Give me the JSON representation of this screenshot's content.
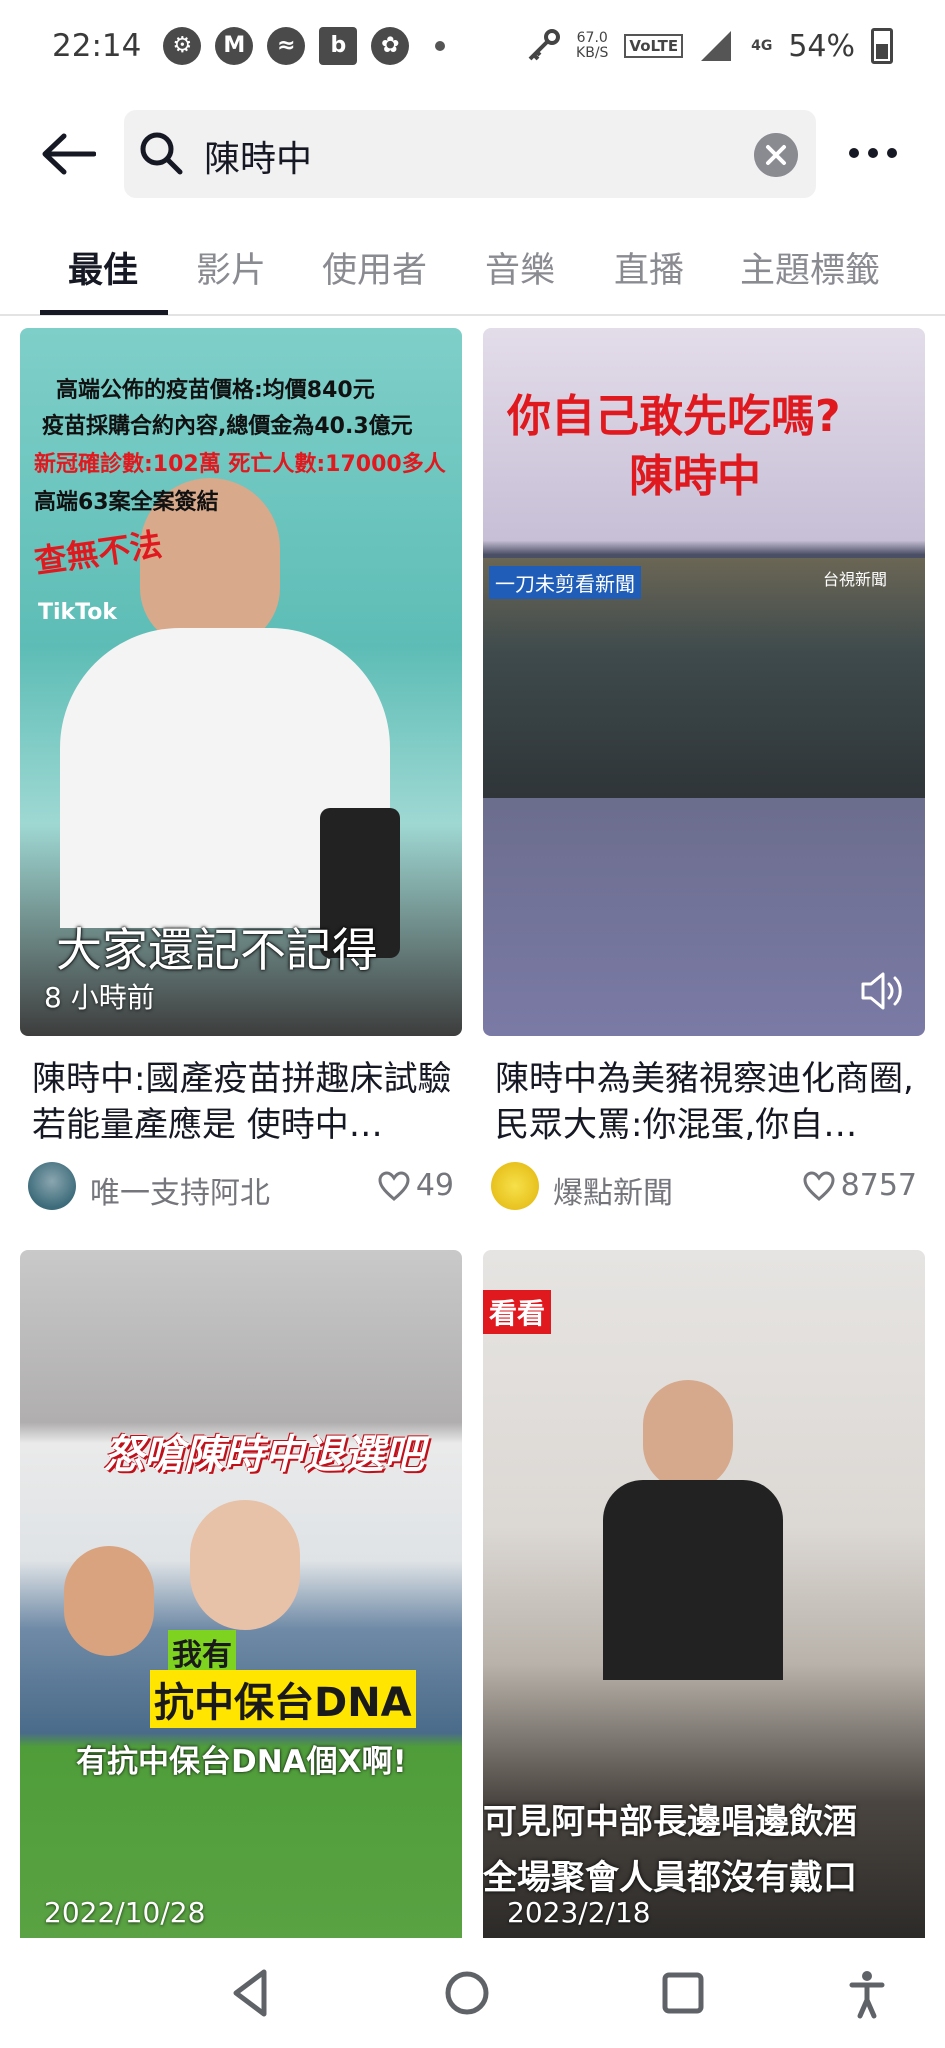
{
  "status_bar": {
    "time": "22:14",
    "net_speed_value": "67.0",
    "net_speed_unit": "KB/S",
    "volte": "VoLTE",
    "network": "4G",
    "battery": "54%"
  },
  "search": {
    "query": "陳時中",
    "back_icon": "arrow-left-icon",
    "clear_icon": "close-circle-icon",
    "more_icon": "ellipsis-icon"
  },
  "tabs": [
    {
      "label": "最佳",
      "active": true
    },
    {
      "label": "影片",
      "active": false
    },
    {
      "label": "使用者",
      "active": false
    },
    {
      "label": "音樂",
      "active": false
    },
    {
      "label": "直播",
      "active": false
    },
    {
      "label": "主題標籤",
      "active": false
    }
  ],
  "videos": [
    {
      "overlay_time": "8 小時前",
      "overlay_lines": [
        "高端公佈的疫苗價格:均價840元",
        "疫苗採購合約內容,總價金為40.3億元",
        "新冠確診數:102萬 死亡人數:17000多人",
        "高端63案全案簽結",
        "查無不法",
        "TikTok",
        "大家還記不記得"
      ],
      "caption": "陳時中:國產疫苗拼趣床試驗 若能量產應是 使時中…",
      "author": "唯一支持阿北",
      "likes": "49"
    },
    {
      "overlay_time": "",
      "overlay_lines": [
        "你自己敢先吃嗎?",
        "陳時中",
        "一刀未剪看新聞",
        "台視新聞"
      ],
      "caption": "陳時中為美豬視察迪化商圈,民眾大罵:你混蛋,你自…",
      "author": "爆點新聞",
      "likes": "8757"
    },
    {
      "overlay_time": "2022/10/28",
      "overlay_lines": [
        "怒嗆陳時中退選吧",
        "我有",
        "抗中保台DNA",
        "有抗中保台DNA個X啊!"
      ],
      "caption": "",
      "author": "",
      "likes": ""
    },
    {
      "overlay_time": "2023/2/18",
      "overlay_lines": [
        "看看",
        "可見阿中部長邊唱邊飲酒",
        "全場聚會人員都沒有戴口"
      ],
      "caption": "",
      "author": "",
      "likes": ""
    }
  ],
  "colors": {
    "accent_red": "#e0191f",
    "text_primary": "#161823",
    "text_secondary": "#75767c"
  }
}
